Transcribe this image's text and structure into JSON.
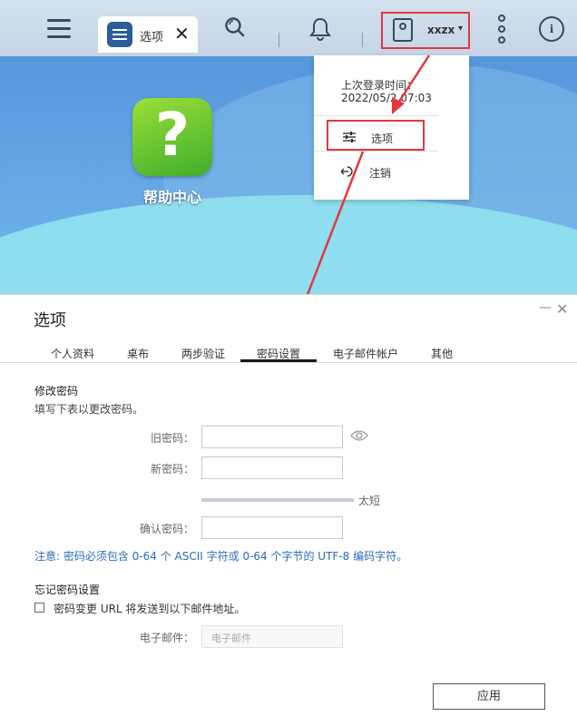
{
  "topbar": {
    "tab_label": "选项",
    "tab_close": "✕",
    "user_name": "xxzx",
    "user_caret": "▾",
    "info_glyph": "i"
  },
  "desktop": {
    "app_label": "帮助中心",
    "app_glyph": "?"
  },
  "user_menu": {
    "last_login_label": "上次登录时间：",
    "last_login_time": "2022/05/2  07:03",
    "options_label": "选项",
    "logout_label": "注销"
  },
  "dialog": {
    "title": "选项",
    "minimize": "—",
    "close": "✕",
    "tabs": [
      "个人资料",
      "桌布",
      "两步验证",
      "密码设置",
      "电子邮件帐户",
      "其他"
    ],
    "active_tab": "密码设置",
    "change_password": {
      "title": "修改密码",
      "desc": "填写下表以更改密码。",
      "old_label": "旧密码：",
      "new_label": "新密码：",
      "strength_label": "太短",
      "confirm_label": "确认密码：",
      "note": "注意: 密码必须包含 0-64 个 ASCII 字符或 0-64 个字节的 UTF-8 编码字符。"
    },
    "forgot_password": {
      "title": "忘记密码设置",
      "checkbox_label": "密码变更 URL 将发送到以下邮件地址。",
      "checked": false,
      "email_label": "电子邮件：",
      "email_placeholder": "电子邮件"
    },
    "apply_label": "应用"
  },
  "colors": {
    "highlight": "#e0393e",
    "note": "#2a6db5",
    "tab_icon": "#2c5c9a"
  }
}
